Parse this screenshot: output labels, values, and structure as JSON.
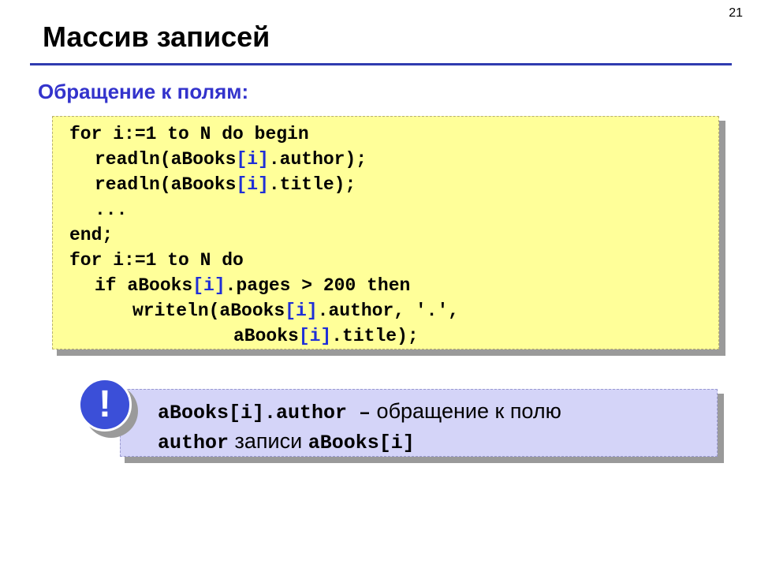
{
  "page_number": "21",
  "title": "Массив записей",
  "subtitle": "Обращение к полям:",
  "code": {
    "line1": "for i:=1 to N do begin",
    "line2_pre": "readln(aBooks",
    "line2_hl": "[i]",
    "line2_post": ".author);",
    "line3_pre": "readln(aBooks",
    "line3_hl": "[i]",
    "line3_post": ".title);",
    "line4": "...",
    "line5": "end;",
    "line6": "for i:=1 to N do",
    "line7_pre": "if aBooks",
    "line7_hl": "[i]",
    "line7_post": ".pages > 200 then",
    "line8_pre": "writeln(aBooks",
    "line8_hl": "[i]",
    "line8_post": ".author, '.',",
    "line9_pre": "aBooks",
    "line9_hl": "[i]",
    "line9_post": ".title);"
  },
  "note": {
    "icon_glyph": "!",
    "expr": "aBooks[i].author –",
    "text1": " обращение к полю",
    "field": "author",
    "text2": " записи ",
    "record": "aBooks[i]"
  },
  "colors": {
    "title_rule": "#2f3bb0",
    "subtitle": "#3333cc",
    "code_bg": "#ffff99",
    "highlight": "#1f2fd6",
    "note_bg": "#d4d4f8",
    "alert_icon": "#3b4fd8"
  }
}
